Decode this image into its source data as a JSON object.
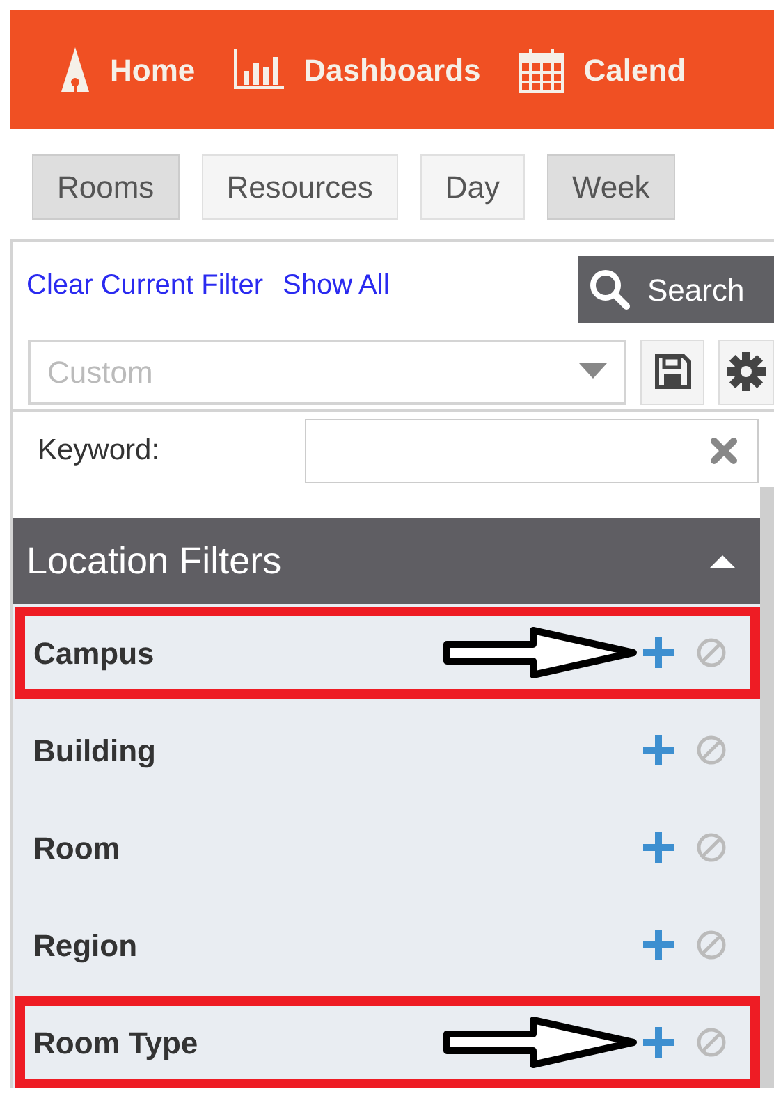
{
  "nav": [
    {
      "label": "Home"
    },
    {
      "label": "Dashboards"
    },
    {
      "label": "Calend"
    }
  ],
  "tabs": [
    {
      "label": "Rooms",
      "selected": true
    },
    {
      "label": "Resources",
      "selected": false
    },
    {
      "label": "Day",
      "selected": false
    },
    {
      "label": "Week",
      "selected": true
    }
  ],
  "links": [
    "Clear Current Filter",
    "Show All"
  ],
  "search_button": "Search",
  "filter_select": {
    "value": "Custom"
  },
  "keyword": {
    "label": "Keyword:"
  },
  "section": {
    "title": "Location Filters",
    "expanded": true
  },
  "filters": [
    {
      "label": "Campus",
      "highlighted": true
    },
    {
      "label": "Building",
      "highlighted": false
    },
    {
      "label": "Room",
      "highlighted": false
    },
    {
      "label": "Region",
      "highlighted": false
    },
    {
      "label": "Room Type",
      "highlighted": true
    }
  ]
}
